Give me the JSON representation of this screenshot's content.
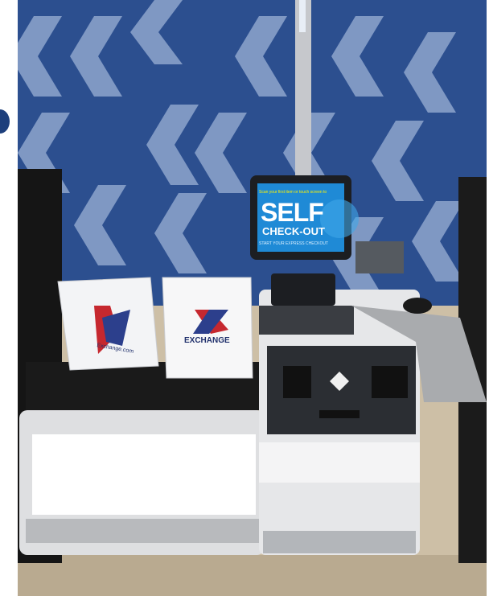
{
  "photo": {
    "screen_headline": "Scan your first item or touch screen to",
    "screen_title_line1": "SELF",
    "screen_title_line2": "CHECK-OUT",
    "screen_footer": "START YOUR EXPRESS CHECKOUT",
    "bag_brand": "EXCHANGE",
    "bag_small_text": "Exchange.com",
    "colors": {
      "wall": "#2c4f8f",
      "chevron": "#8fa6cf",
      "kiosk_body": "#e7e8ea",
      "counter": "#141414",
      "floor": "#c9b89e",
      "screen_blue": "#1f8ad6"
    }
  }
}
